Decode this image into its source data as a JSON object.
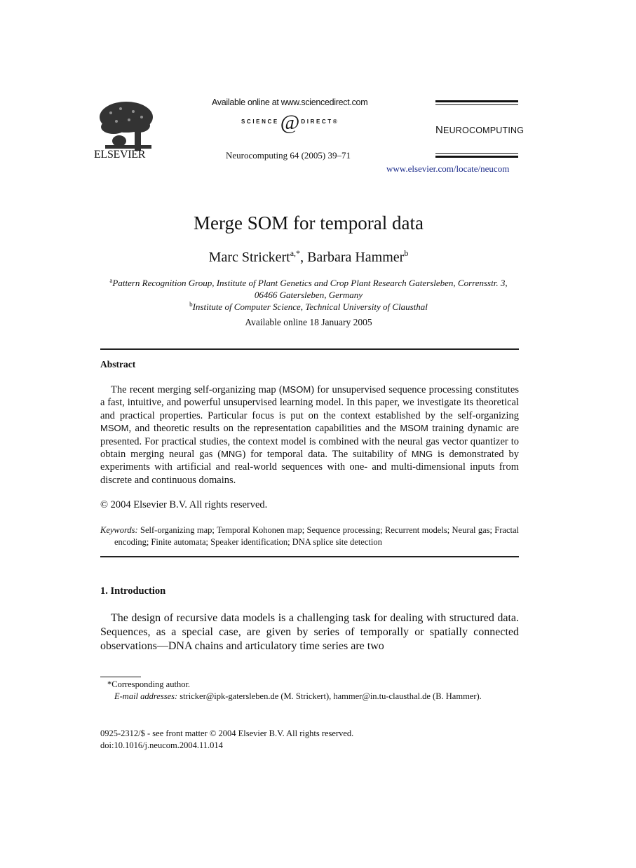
{
  "header": {
    "publisher_logo_word": "ELSEVIER",
    "sciencedirect_available": "Available online at www.sciencedirect.com",
    "sciencedirect_left": "SCIENCE",
    "sciencedirect_at": "@",
    "sciencedirect_right": "DIRECT",
    "sciencedirect_mark": "®",
    "journal_ref": "Neurocomputing 64 (2005) 39–71",
    "journal_name_cap": "N",
    "journal_name_rest": "EUROCOMPUTING",
    "journal_url": "www.elsevier.com/locate/neucom"
  },
  "paper": {
    "title": "Merge SOM for temporal data",
    "authors": [
      {
        "name": "Marc Strickert",
        "sup": "a,*"
      },
      {
        "name": "Barbara Hammer",
        "sup": "b"
      }
    ],
    "author_separator": ", ",
    "affiliations": [
      {
        "sup": "a",
        "text": "Pattern Recognition Group, Institute of Plant Genetics and Crop Plant Research Gatersleben, Corrensstr. 3, 06466 Gatersleben, Germany"
      },
      {
        "sup": "b",
        "text": "Institute of Computer Science, Technical University of Clausthal"
      }
    ],
    "available_online": "Available online 18 January 2005"
  },
  "abstract": {
    "heading": "Abstract",
    "body": "The recent merging self-organizing map (MSOM) for unsupervised sequence processing constitutes a fast, intuitive, and powerful unsupervised learning model. In this paper, we investigate its theoretical and practical properties. Particular focus is put on the context established by the self-organizing MSOM, and theoretic results on the representation capabilities and the MSOM training dynamic are presented. For practical studies, the context model is combined with the neural gas vector quantizer to obtain merging neural gas (MNG) for temporal data. The suitability of MNG is demonstrated by experiments with artificial and real-world sequences with one- and multi-dimensional inputs from discrete and continuous domains.",
    "copyright": "© 2004 Elsevier B.V. All rights reserved.",
    "keywords_label": "Keywords:",
    "keywords": "Self-organizing map; Temporal Kohonen map; Sequence processing; Recurrent models; Neural gas; Fractal encoding; Finite automata; Speaker identification; DNA splice site detection"
  },
  "introduction": {
    "heading": "1.  Introduction",
    "body": "The design of recursive data models is a challenging task for dealing with structured data. Sequences, as a special case, are given by series of temporally or spatially connected observations—DNA chains and articulatory time series are two"
  },
  "footnotes": {
    "corresponding": "*Corresponding author.",
    "email_label": "E-mail addresses:",
    "email_text": "stricker@ipk-gatersleben.de (M. Strickert), hammer@in.tu-clausthal.de (B. Hammer).",
    "issn": "0925-2312/$ - see front matter © 2004 Elsevier B.V. All rights reserved.",
    "doi": "doi:10.1016/j.neucom.2004.11.014"
  }
}
